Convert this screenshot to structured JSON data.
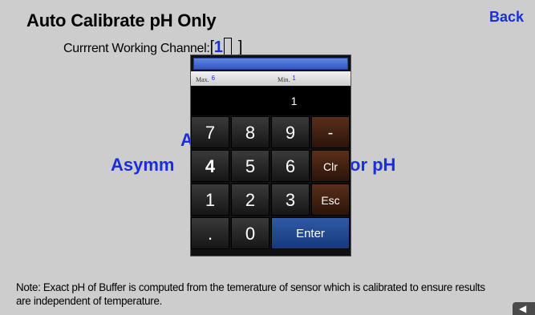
{
  "header": {
    "title": "Auto Calibrate pH Only",
    "back_label": "Back"
  },
  "channel": {
    "label": "Currrent Working Channel:",
    "open_bracket": "[",
    "value": "1",
    "close_bracket": "]"
  },
  "background": {
    "heading1_visible": "A",
    "heading2_left": "Asymm",
    "heading2_right": "or pH"
  },
  "keypad": {
    "max_label": "Max.",
    "max_value": "6",
    "min_label": "Min.",
    "min_value": "1",
    "display_value": "1",
    "keys": {
      "k7": "7",
      "k8": "8",
      "k9": "9",
      "minus": "-",
      "k4": "4",
      "k5": "5",
      "k6": "6",
      "clr": "Clr",
      "k1": "1",
      "k2": "2",
      "k3": "3",
      "esc": "Esc",
      "dot": ".",
      "k0": "0",
      "enter": "Enter"
    }
  },
  "note": {
    "text": "Note: Exact pH of Buffer is computed from the temerature of sensor which is calibrated to ensure results are independent of temperature."
  },
  "colors": {
    "background": "#cdcdcd",
    "accent_blue": "#1a2fd8"
  },
  "icons": {
    "corner": "arrow-left-icon"
  }
}
